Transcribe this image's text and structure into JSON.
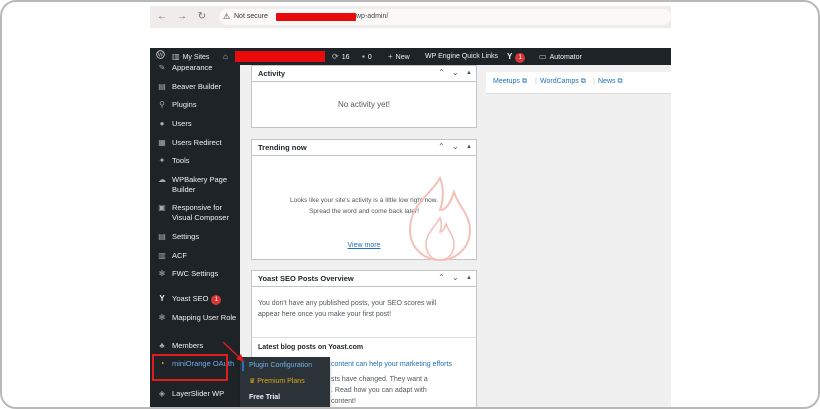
{
  "browser": {
    "nav_back": "←",
    "nav_forward": "→",
    "nav_reload": "↻",
    "not_secure_label": "Not secure",
    "url_tail": "wp-admin/"
  },
  "adminbar": {
    "my_sites": "My Sites",
    "comments_count": "16",
    "pending_count": "0",
    "new_label": "New",
    "quick_links": "WP Engine Quick Links",
    "yoast_badge": "1",
    "automator": "Automator"
  },
  "sidebar": {
    "items": [
      {
        "label": "Appearance",
        "icon": "appearance-icon"
      },
      {
        "label": "Beaver Builder",
        "icon": "grid-icon"
      },
      {
        "label": "Plugins",
        "icon": "plugins-icon"
      },
      {
        "label": "Users",
        "icon": "users-icon"
      },
      {
        "label": "Users Redirect",
        "icon": "redirect-icon"
      },
      {
        "label": "Tools",
        "icon": "tools-icon"
      },
      {
        "label": "WPBakery Page Builder",
        "icon": "cloud-icon"
      },
      {
        "label": "Responsive for Visual Composer",
        "icon": "responsive-icon"
      },
      {
        "label": "Settings",
        "icon": "settings-icon"
      },
      {
        "label": "ACF",
        "icon": "acf-icon"
      },
      {
        "label": "FWC Settings",
        "icon": "gear-icon"
      },
      {
        "label": "Yoast SEO",
        "icon": "yoast-icon",
        "badge": "1"
      },
      {
        "label": "Mapping User Role",
        "icon": "gear-icon"
      },
      {
        "label": "Members",
        "icon": "members-icon"
      },
      {
        "label": "miniOrange OAuth",
        "icon": "miniorange-icon"
      },
      {
        "label": "LayerSlider WP",
        "icon": "layers-icon"
      }
    ]
  },
  "flyout": {
    "items": [
      "Plugin Configuration",
      "Premium Plans",
      "Free Trial"
    ]
  },
  "activity": {
    "title": "Activity",
    "empty": "No activity yet!"
  },
  "trending": {
    "title": "Trending now",
    "line1": "Looks like your site's activity is a little low right now.",
    "line2": "Spread the word and come back later!",
    "view_more": "View more"
  },
  "yoast": {
    "title": "Yoast SEO Posts Overview",
    "line1": "You don't have any published posts, your SEO scores will",
    "line2": "appear here once you make your first post!",
    "blog_heading": "Latest blog posts on Yoast.com",
    "blog_line1": "content can help your marketing efforts",
    "blog_line2": "sts have changed. They want a",
    "blog_line3": ". Read how you can adapt with",
    "blog_line4": "content!"
  },
  "right_panel": {
    "links": [
      "Meetups",
      "WordCamps",
      "News"
    ]
  },
  "colors": {
    "admin_dark": "#1d2327",
    "link_blue": "#2271b1",
    "badge_red": "#d63638",
    "highlight_red": "#e21b1b",
    "premium_gold": "#dba617"
  }
}
